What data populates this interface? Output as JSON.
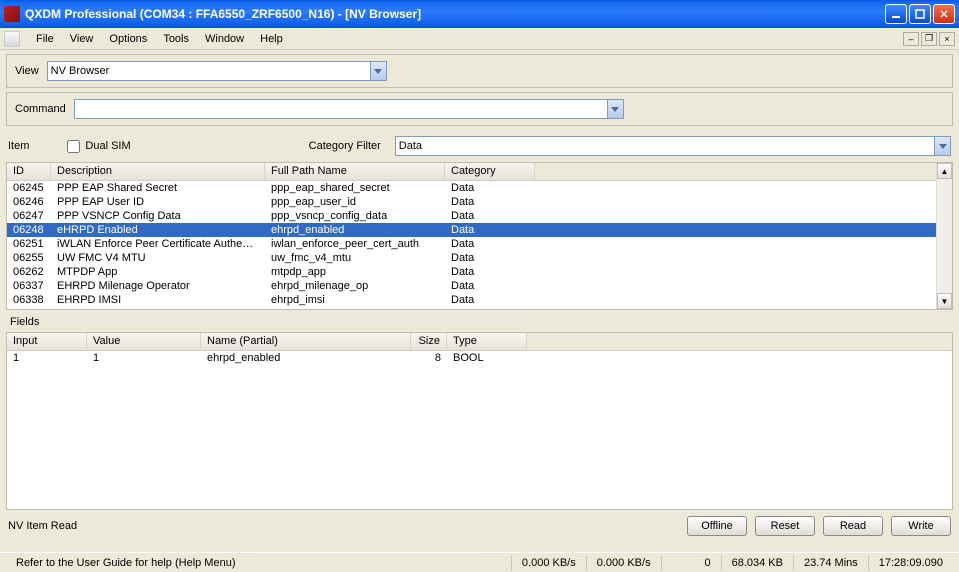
{
  "window": {
    "title": "QXDM Professional (COM34 : FFA6550_ZRF6500_N16) - [NV Browser]"
  },
  "menu": {
    "items": [
      "File",
      "View",
      "Options",
      "Tools",
      "Window",
      "Help"
    ]
  },
  "view_row": {
    "label": "View",
    "value": "NV Browser"
  },
  "command_row": {
    "label": "Command",
    "value": ""
  },
  "item_row": {
    "label": "Item",
    "dual_sim_label": "Dual SIM",
    "dual_sim_checked": false,
    "cat_filter_label": "Category Filter",
    "cat_filter_value": "Data"
  },
  "nv_list": {
    "columns": [
      "ID",
      "Description",
      "Full Path Name",
      "Category"
    ],
    "rows": [
      {
        "id": "06245",
        "desc": "PPP EAP Shared Secret",
        "path": "ppp_eap_shared_secret",
        "cat": "Data",
        "selected": false
      },
      {
        "id": "06246",
        "desc": "PPP EAP User ID",
        "path": "ppp_eap_user_id",
        "cat": "Data",
        "selected": false
      },
      {
        "id": "06247",
        "desc": "PPP VSNCP Config Data",
        "path": "ppp_vsncp_config_data",
        "cat": "Data",
        "selected": false
      },
      {
        "id": "06248",
        "desc": "eHRPD Enabled",
        "path": "ehrpd_enabled",
        "cat": "Data",
        "selected": true
      },
      {
        "id": "06251",
        "desc": "iWLAN Enforce Peer Certificate Authenti...",
        "path": "iwlan_enforce_peer_cert_auth",
        "cat": "Data",
        "selected": false
      },
      {
        "id": "06255",
        "desc": "UW FMC V4 MTU",
        "path": "uw_fmc_v4_mtu",
        "cat": "Data",
        "selected": false
      },
      {
        "id": "06262",
        "desc": "MTPDP App",
        "path": "mtpdp_app",
        "cat": "Data",
        "selected": false
      },
      {
        "id": "06337",
        "desc": "EHRPD Milenage Operator",
        "path": "ehrpd_milenage_op",
        "cat": "Data",
        "selected": false
      },
      {
        "id": "06338",
        "desc": "EHRPD IMSI",
        "path": "ehrpd_imsi",
        "cat": "Data",
        "selected": false
      }
    ]
  },
  "fields": {
    "label": "Fields",
    "columns": [
      "Input",
      "Value",
      "Name (Partial)",
      "Size",
      "Type"
    ],
    "rows": [
      {
        "input": "1",
        "value": "1",
        "name": "ehrpd_enabled",
        "size": "8",
        "type": "BOOL"
      }
    ]
  },
  "bottom": {
    "status": "NV Item Read",
    "buttons": {
      "offline": "Offline",
      "reset": "Reset",
      "read": "Read",
      "write": "Write"
    }
  },
  "statusbar": {
    "help": "Refer to the User Guide for help (Help Menu)",
    "rate1": "0.000 KB/s",
    "rate2": "0.000 KB/s",
    "num": "0",
    "kb": "68.034 KB",
    "mins": "23.74 Mins",
    "time": "17:28:09.090"
  }
}
